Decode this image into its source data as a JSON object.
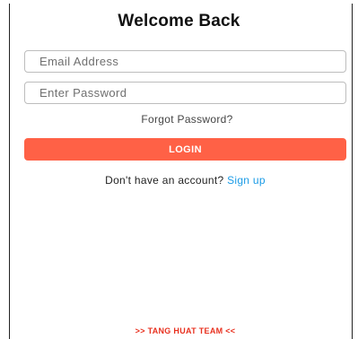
{
  "header": {
    "title": "Welcome Back"
  },
  "form": {
    "email_placeholder": "Email Address",
    "email_value": "",
    "password_placeholder": "Enter Password",
    "password_value": "",
    "forgot_label": "Forgot Password?",
    "login_label": "LOGIN"
  },
  "signup": {
    "prompt": "Don't have an account? ",
    "link_label": "Sign up"
  },
  "footer": {
    "credit": ">> TANG HUAT TEAM <<"
  },
  "colors": {
    "accent": "#ff6146",
    "link": "#1a9be6",
    "footer_text": "#e8311f"
  }
}
